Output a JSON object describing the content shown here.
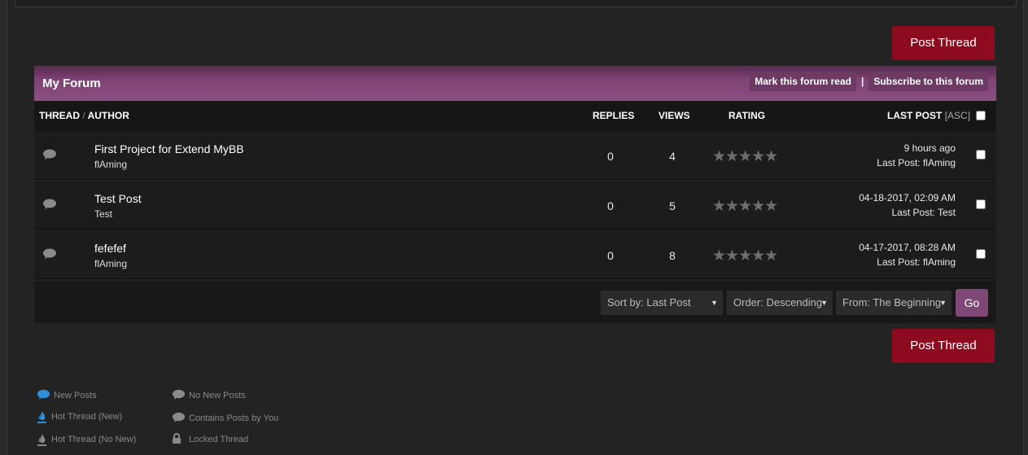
{
  "post_thread_label": "Post Thread",
  "forum": {
    "title": "My Forum",
    "mark_read": "Mark this forum read",
    "separator": "|",
    "subscribe": "Subscribe to this forum"
  },
  "columns": {
    "thread": "THREAD",
    "slash": "/",
    "author": "AUTHOR",
    "replies": "REPLIES",
    "views": "VIEWS",
    "rating": "RATING",
    "last_post": "LAST POST",
    "asc": "[ASC]"
  },
  "threads": [
    {
      "title": "First Project for Extend MyBB",
      "author": "flAming",
      "replies": "0",
      "views": "4",
      "rating": 0,
      "last_date": "9 hours ago",
      "last_by": "Last Post: flAming"
    },
    {
      "title": "Test Post",
      "author": "Test",
      "replies": "0",
      "views": "5",
      "rating": 0,
      "last_date": "04-18-2017, 02:09 AM",
      "last_by": "Last Post: Test"
    },
    {
      "title": "fefefef",
      "author": "flAming",
      "replies": "0",
      "views": "8",
      "rating": 0,
      "last_date": "04-17-2017, 08:28 AM",
      "last_by": "Last Post: flAming"
    }
  ],
  "stars": "★★★★★",
  "sort": {
    "sort_by": "Sort by: Last Post",
    "order": "Order: Descending",
    "from": "From: The Beginning",
    "arrow": "▼",
    "go": "Go"
  },
  "legend": {
    "new_posts": "New Posts",
    "no_new_posts": "No New Posts",
    "hot_new": "Hot Thread (New)",
    "contains_yours": "Contains Posts by You",
    "hot_no_new": "Hot Thread (No New)",
    "locked": "Locked Thread"
  },
  "colors": {
    "accent": "#8e0a1f",
    "header_purple": "#8a4f80",
    "new_posts_blue": "#2f8fd8"
  }
}
